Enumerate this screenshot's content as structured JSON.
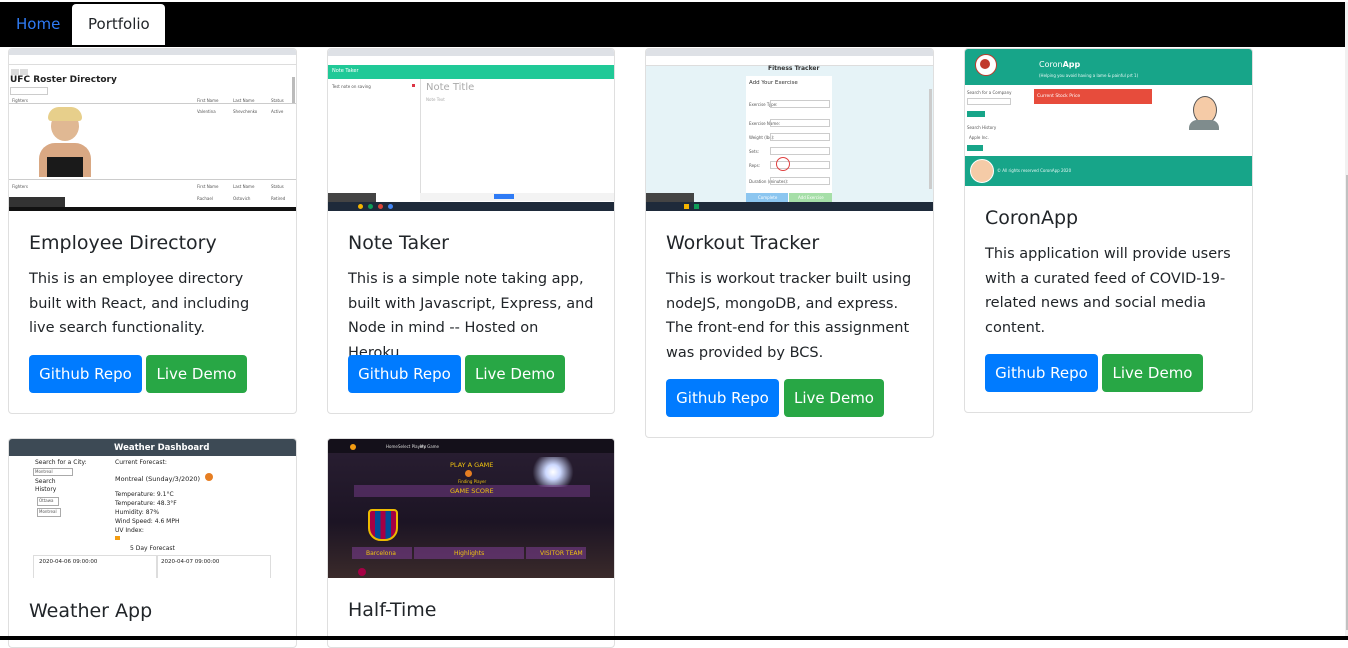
{
  "nav": {
    "home": "Home",
    "portfolio": "Portfolio"
  },
  "projects": [
    {
      "title": "Employee Directory",
      "description": "This is an employee directory built with React, and including live search functionality.",
      "github": "Github Repo",
      "demo": "Live Demo",
      "thumb": {
        "heading": "UFC Roster Directory",
        "col1": "Fighters",
        "col2": "First Name",
        "col3": "Last Name",
        "col4": "Status",
        "row1": [
          "Valentina",
          "Shevchenko",
          "Active"
        ],
        "row2": [
          "Rachael",
          "Ostovich",
          "Retired"
        ]
      }
    },
    {
      "title": "Note Taker",
      "description": "This is a simple note taking app, built with Javascript, Express, and Node in mind -- Hosted on Heroku",
      "github": "Github Repo",
      "demo": "Live Demo",
      "thumb": {
        "appbar": "Note Taker",
        "note_title": "Note Title",
        "note_text": "Note Text",
        "list_item": "Test note on saving"
      }
    },
    {
      "title": "Workout Tracker",
      "description": "This is workout tracker built using nodeJS, mongoDB, and express. The front-end for this assignment was provided by BCS.",
      "github": "Github Repo",
      "demo": "Live Demo",
      "thumb": {
        "heading": "Fitness Tracker",
        "form_title": "Add Your Exercise",
        "labels": [
          "Exercise Type:",
          "Exercise Name:",
          "Weight (lbs):",
          "Sets:",
          "Reps:",
          "Duration (minutes):"
        ],
        "values": [
          "Resistance",
          "Dumbbell Press",
          "200",
          "3",
          "12",
          ""
        ],
        "complete": "Complete",
        "add": "Add Exercise"
      }
    },
    {
      "title": "CoronApp",
      "description": "This application will provide users with a curated feed of COVID-19-related news and social media content.",
      "github": "Github Repo",
      "demo": "Live Demo",
      "thumb": {
        "brand_light": "Coron",
        "brand_bold": "App",
        "tagline": "(Helping you avoid having a lame & painful prt 1)",
        "search_label": "Search for a Company",
        "search_btn": "Search",
        "history_label": "Search History",
        "history_item": "Apple Inc.",
        "clear_btn": "Clear",
        "banner": "Current Stock Price",
        "footer": "© All rights reserved CoronApp 2020"
      }
    },
    {
      "title": "Weather App",
      "thumb": {
        "header": "Weather Dashboard",
        "search_label": "Search for a City:",
        "search_value": "Montreal",
        "history_label": "Search History",
        "history1": "Ottawa",
        "history2": "Montreal",
        "current_label": "Current Forecast:",
        "city": "Montreal (Sunday/3/2020)",
        "temp_c": "Temperature: 9.1°C",
        "temp_f": "Temperature: 48.3°F",
        "humidity": "Humidity: 87%",
        "wind": "Wind Speed: 4.6 MPH",
        "uv": "UV Index:",
        "five_day": "5 Day Forecast",
        "day1": "2020-04-06 09:00:00",
        "day2": "2020-04-07 09:00:00"
      }
    },
    {
      "title": "Half-Time",
      "thumb": {
        "play": "PLAY A GAME",
        "finding": "Finding Player",
        "score": "GAME SCORE",
        "team_home": "Barcelona",
        "highlights": "Highlights",
        "visitor": "VISITOR TEAM",
        "nav1": "Home",
        "nav2": "Select Players",
        "nav3": "My Game"
      }
    }
  ]
}
